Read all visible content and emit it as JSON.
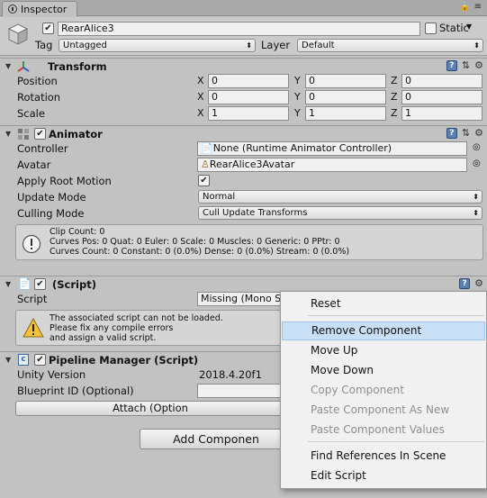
{
  "tab": {
    "title": "Inspector"
  },
  "header": {
    "object_name": "RearAlice3",
    "static_label": "Static",
    "tag_label": "Tag",
    "tag_value": "Untagged",
    "layer_label": "Layer",
    "layer_value": "Default"
  },
  "transform": {
    "title": "Transform",
    "rows": [
      {
        "label": "Position",
        "x": "0",
        "y": "0",
        "z": "0"
      },
      {
        "label": "Rotation",
        "x": "0",
        "y": "0",
        "z": "0"
      },
      {
        "label": "Scale",
        "x": "1",
        "y": "1",
        "z": "1"
      }
    ],
    "axis": {
      "x": "X",
      "y": "Y",
      "z": "Z"
    }
  },
  "animator": {
    "title": "Animator",
    "controller_label": "Controller",
    "controller_value": "None (Runtime Animator Controller)",
    "avatar_label": "Avatar",
    "avatar_value": "RearAlice3Avatar",
    "root_motion_label": "Apply Root Motion",
    "update_mode_label": "Update Mode",
    "update_mode_value": "Normal",
    "culling_mode_label": "Culling Mode",
    "culling_mode_value": "Cull Update Transforms",
    "info": "Clip Count: 0\nCurves Pos: 0 Quat: 0 Euler: 0 Scale: 0 Muscles: 0 Generic: 0 PPtr: 0\nCurves Count: 0 Constant: 0 (0.0%) Dense: 0 (0.0%) Stream: 0 (0.0%)"
  },
  "missing_script": {
    "title": "(Script)",
    "script_label": "Script",
    "script_value": "Missing (Mono S",
    "warning": "The associated script can not be loaded.\nPlease fix any compile errors\nand assign a valid script."
  },
  "pipeline": {
    "title": "Pipeline Manager (Script)",
    "version_label": "Unity Version",
    "version_value": "2018.4.20f1",
    "blueprint_label": "Blueprint ID (Optional)",
    "blueprint_value": "",
    "attach_label": "Attach (Option"
  },
  "add_component_label": "Add Componen",
  "context_menu": {
    "items": [
      {
        "label": "Reset",
        "enabled": true
      },
      {
        "label": "Remove Component",
        "enabled": true,
        "highlighted": true
      },
      {
        "label": "Move Up",
        "enabled": true
      },
      {
        "label": "Move Down",
        "enabled": true
      },
      {
        "label": "Copy Component",
        "enabled": false
      },
      {
        "label": "Paste Component As New",
        "enabled": false
      },
      {
        "label": "Paste Component Values",
        "enabled": false
      },
      {
        "label": "Find References In Scene",
        "enabled": true
      },
      {
        "label": "Edit Script",
        "enabled": true
      }
    ]
  },
  "colors": {
    "panel": "#c2c2c2",
    "menu_highlight": "#c9dff5",
    "disabled_text": "#8f8f8f"
  }
}
